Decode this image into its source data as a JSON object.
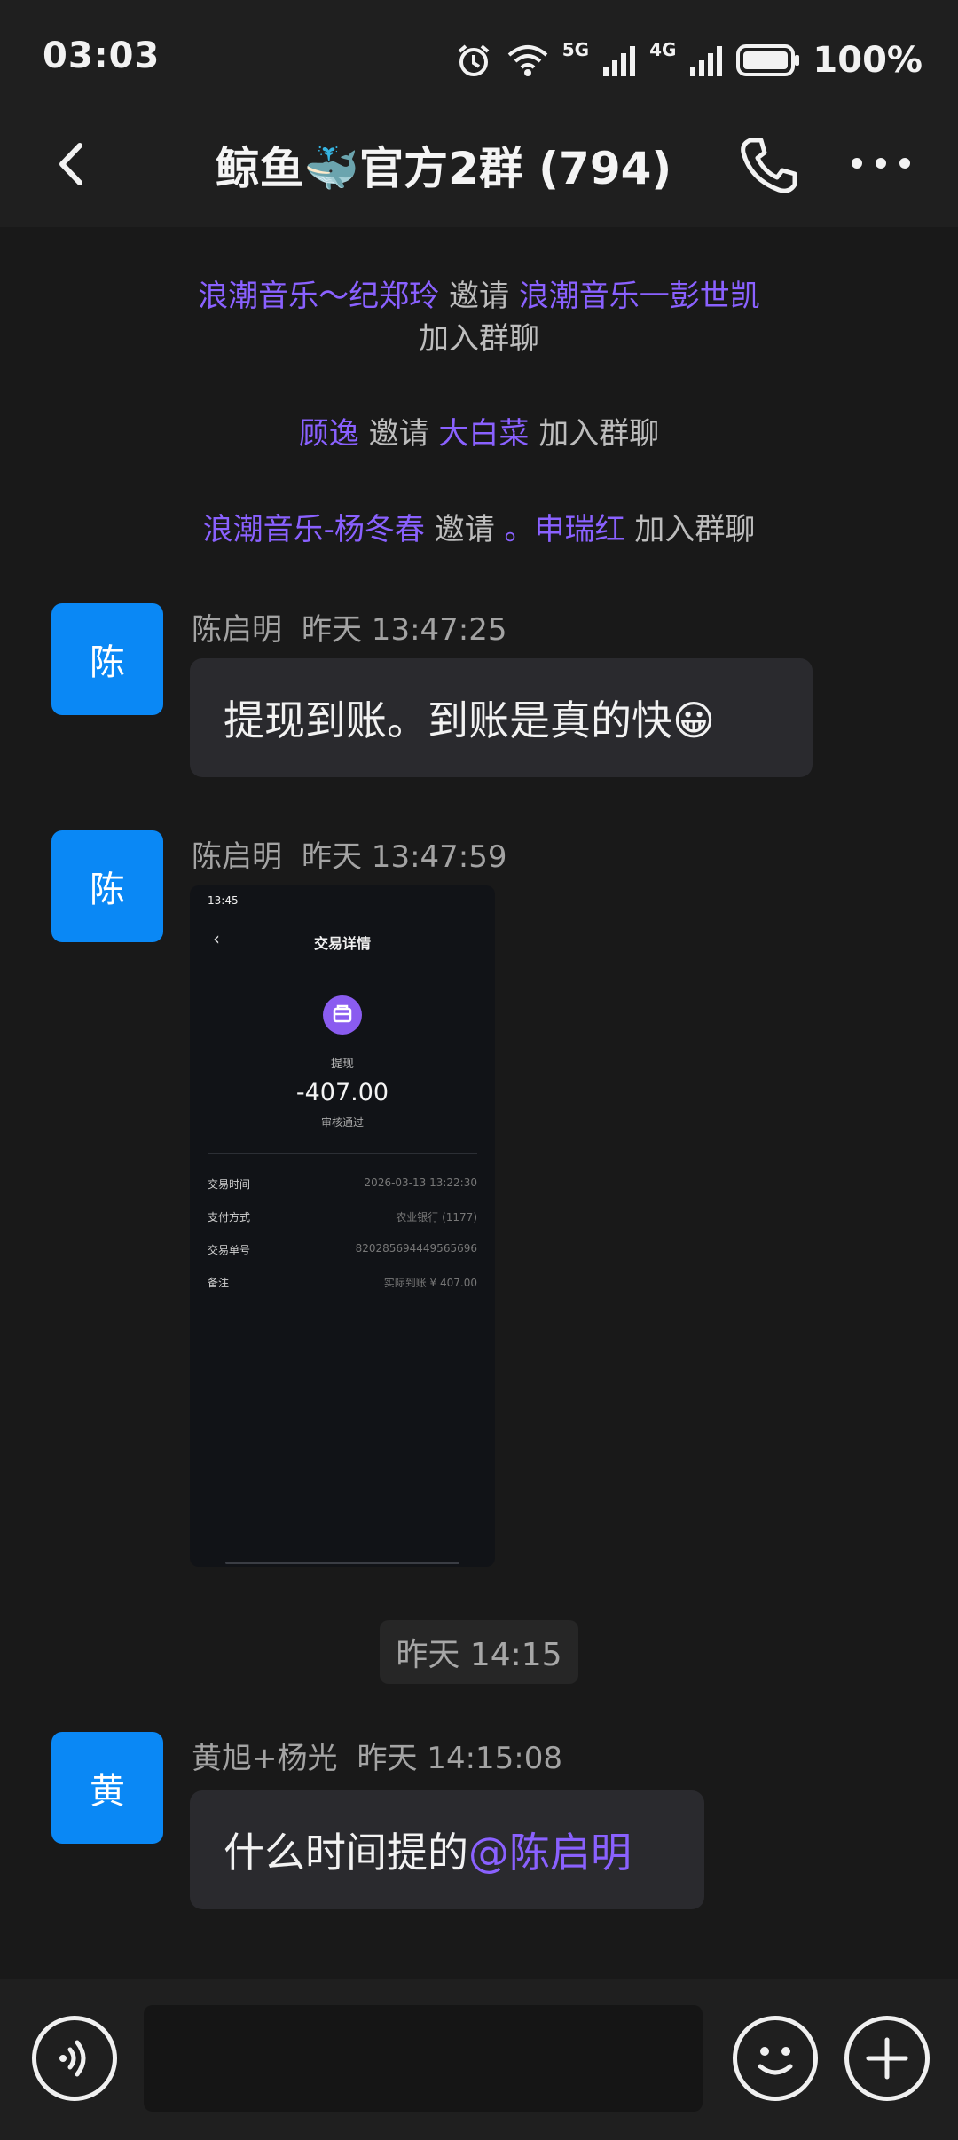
{
  "status_bar": {
    "time": "03:03",
    "battery": "100%",
    "network_5g": "5G",
    "network_4g": "4G"
  },
  "header": {
    "title": "鲸鱼🐳官方2群 (794)"
  },
  "system_messages": [
    {
      "parts": [
        "浪潮音乐～纪郑玲",
        " 邀请 ",
        "浪潮音乐一彭世凯"
      ],
      "line2": "加入群聊"
    },
    {
      "parts": [
        "顾逸",
        " 邀请 ",
        "大白菜",
        " 加入群聊"
      ]
    },
    {
      "parts": [
        "浪潮音乐-杨冬春",
        " 邀请 ",
        "。申瑞红",
        " 加入群聊"
      ]
    }
  ],
  "messages": [
    {
      "avatar": "陈",
      "name": "陈启明",
      "time": "昨天 13:47:25",
      "text": "提现到账。到账是真的快😀"
    },
    {
      "avatar": "陈",
      "name": "陈启明",
      "time": "昨天 13:47:59"
    },
    {
      "avatar": "黄",
      "name": "黄旭+杨光",
      "time": "昨天 14:15:08",
      "text": "什么时间提的",
      "mention": "@陈启明"
    }
  ],
  "time_divider": "昨天 14:15",
  "receipt": {
    "status_time": "13:45",
    "title": "交易详情",
    "type_label": "提现",
    "amount": "-407.00",
    "state": "审核通过",
    "rows": [
      {
        "key": "交易时间",
        "value": "2026-03-13 13:22:30"
      },
      {
        "key": "支付方式",
        "value": "农业银行 (1177)"
      },
      {
        "key": "交易单号",
        "value": "820285694449565696"
      },
      {
        "key": "备注",
        "value": "实际到账 ¥ 407.00"
      }
    ]
  },
  "icons": [
    "back-arrow-icon",
    "phone-icon",
    "more-icon",
    "voice-icon",
    "emoji-icon",
    "plus-icon",
    "alarm-icon",
    "wifi-icon",
    "signal-icon",
    "battery-icon"
  ]
}
